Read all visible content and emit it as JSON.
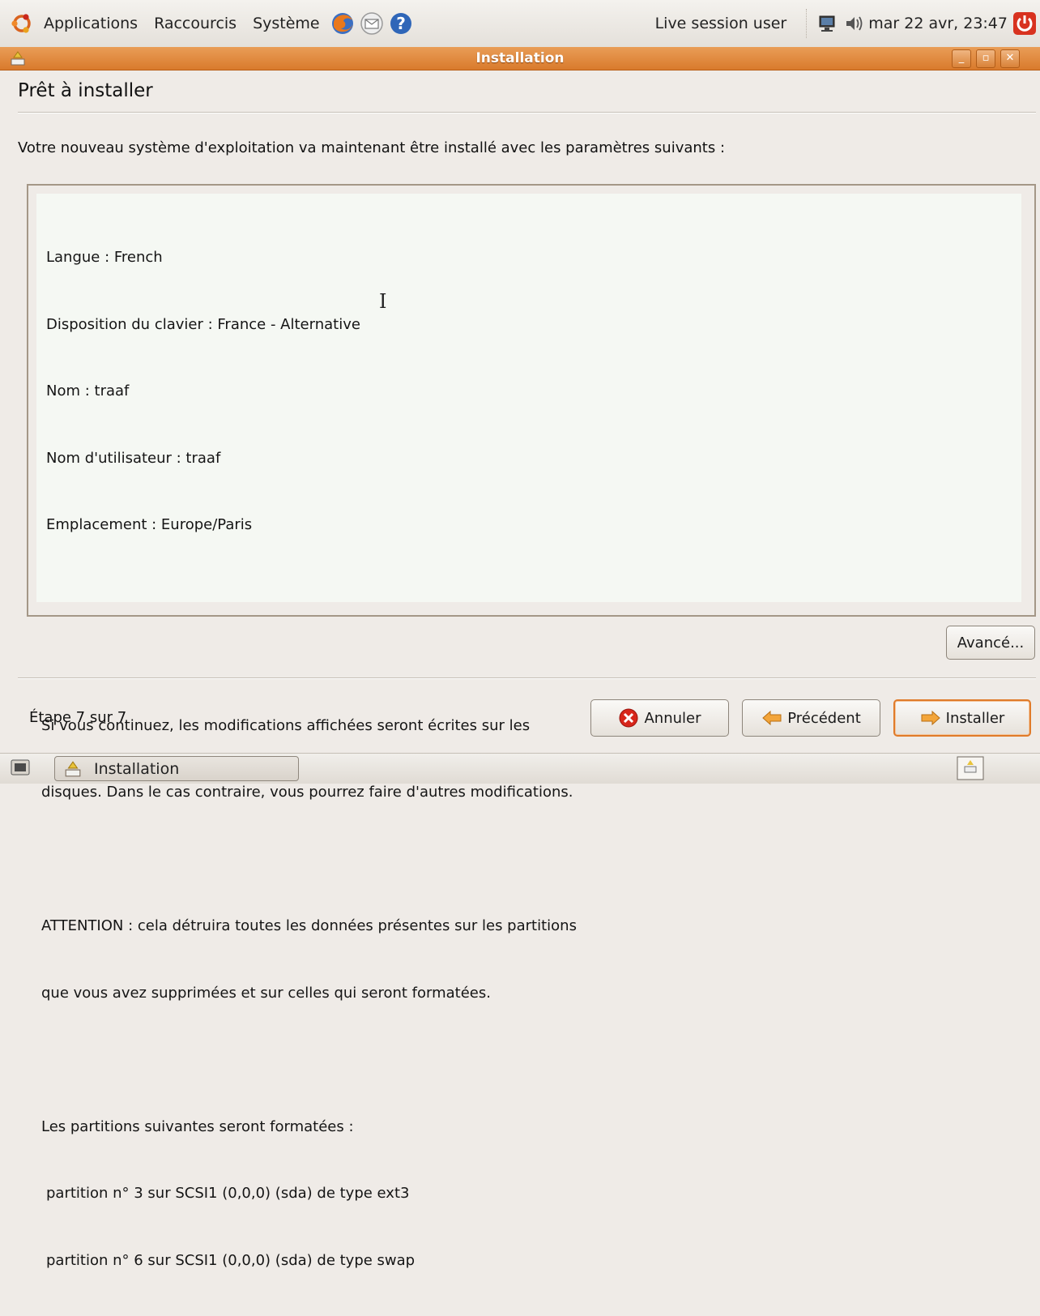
{
  "panel": {
    "menus": [
      "Applications",
      "Raccourcis",
      "Système"
    ],
    "user": "Live session user",
    "clock": "mar 22 avr, 23:47"
  },
  "window": {
    "title": "Installation"
  },
  "page": {
    "heading": "Prêt à installer",
    "intro": "Votre nouveau système d'exploitation va maintenant être installé avec les paramètres suivants :",
    "summary_lines": [
      "Langue : French",
      "Disposition du clavier : France - Alternative",
      "Nom : traaf",
      "Nom d'utilisateur : traaf",
      "Emplacement : Europe/Paris",
      "",
      "",
      "Si vous continuez, les modifications affichées seront écrites sur les",
      "disques. Dans le cas contraire, vous pourrez faire d'autres modifications.",
      "",
      "ATTENTION : cela détruira toutes les données présentes sur les partitions",
      "que vous avez supprimées et sur celles qui seront formatées.",
      "",
      "Les partitions suivantes seront formatées :",
      "partition n° 3 sur SCSI1 (0,0,0) (sda) de type ext3",
      "partition n° 6 sur SCSI1 (0,0,0) (sda) de type swap"
    ],
    "advanced_button": "Avancé...",
    "step": "Étape 7 sur 7",
    "cancel_button": "Annuler",
    "previous_button": "Précédent",
    "install_button": "Installer"
  },
  "taskbar": {
    "task_label": "Installation"
  },
  "colors": {
    "titlebar": "#d97a2c",
    "background": "#efebe7",
    "summary_bg": "#f5f8f3",
    "accent": "#e07b2a"
  }
}
